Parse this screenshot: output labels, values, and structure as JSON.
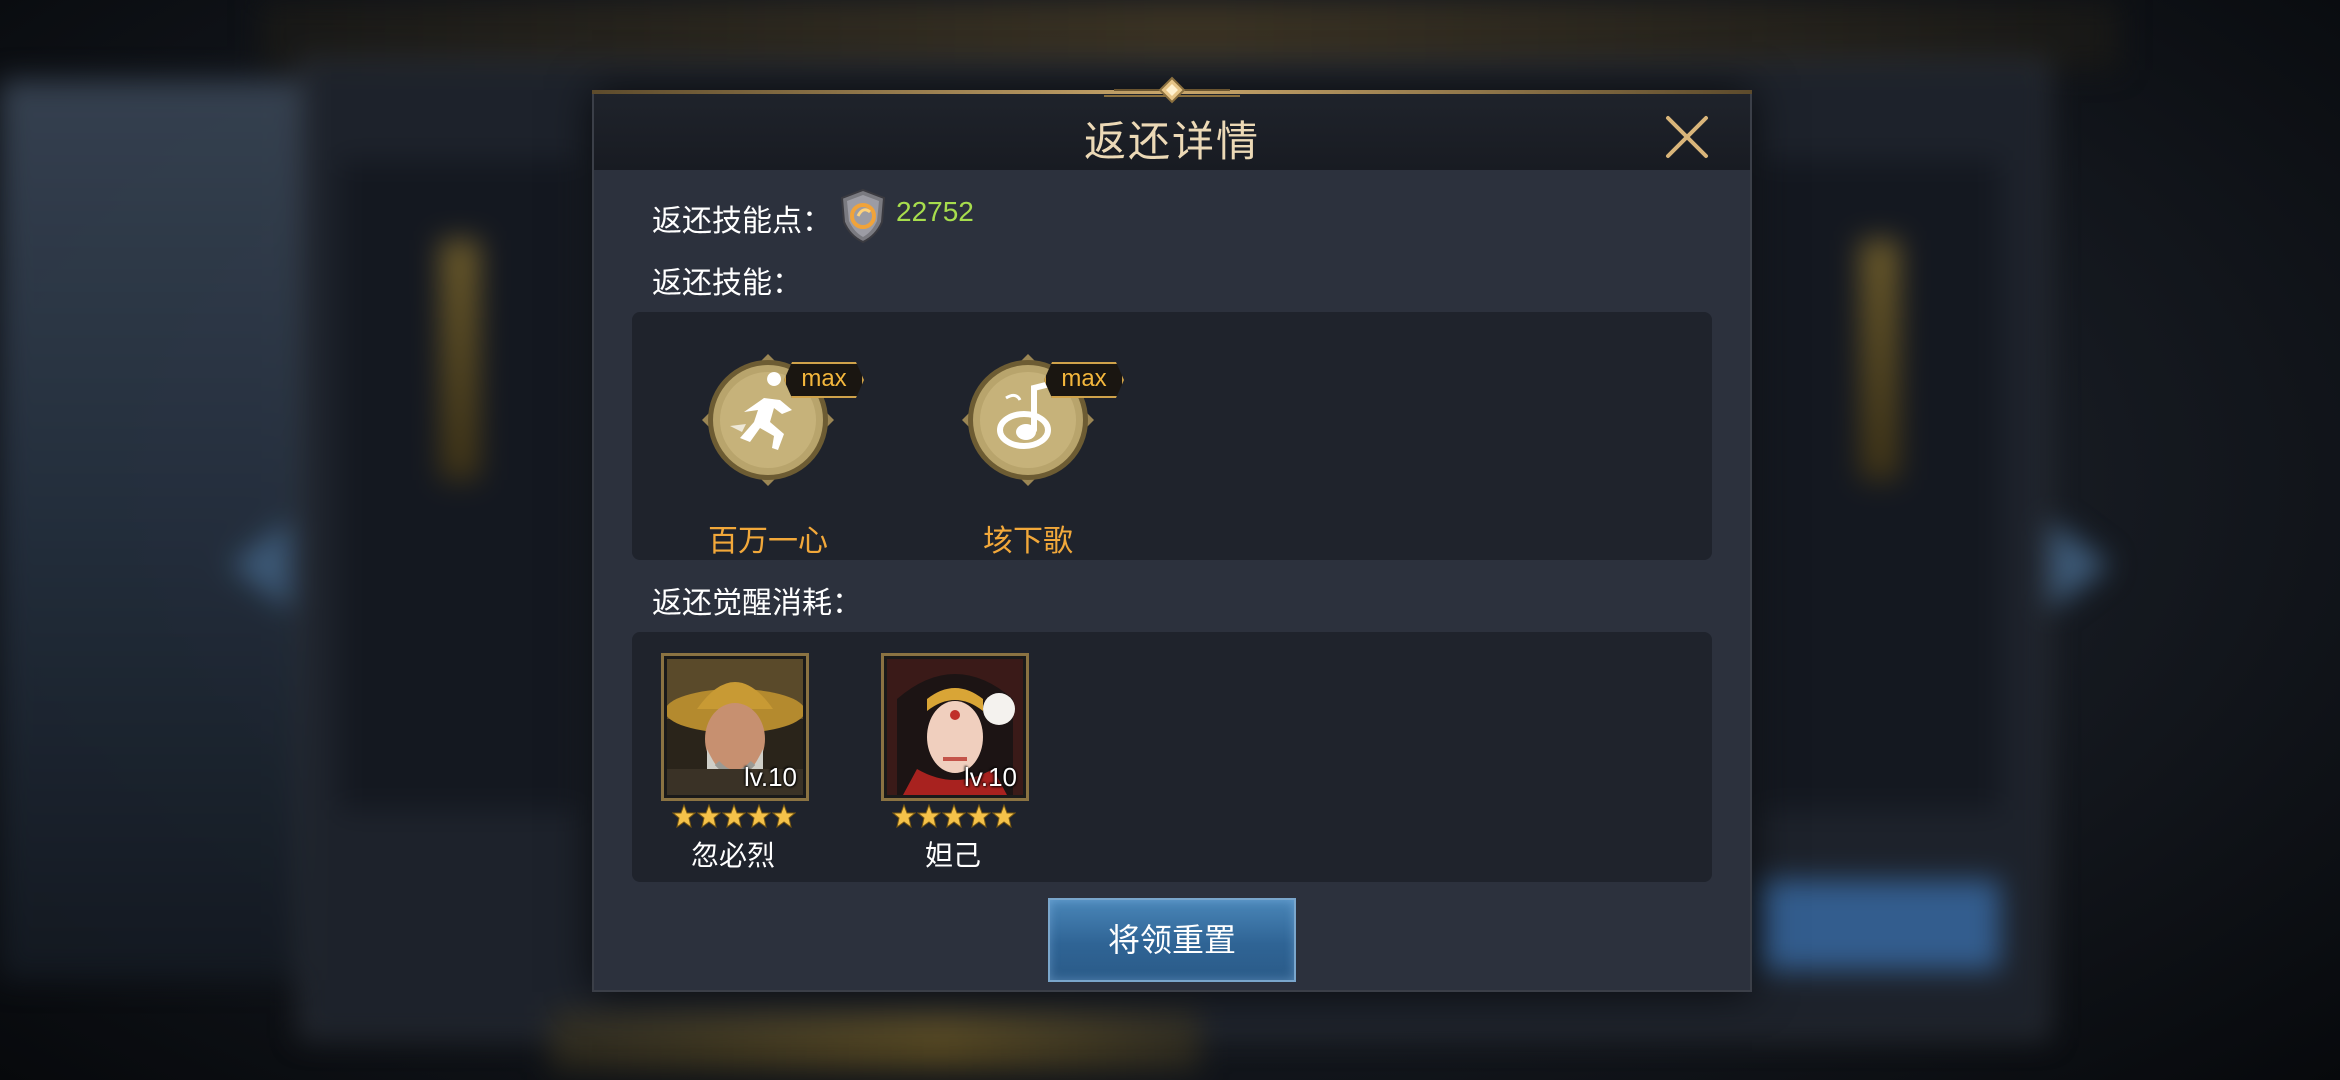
{
  "dialog": {
    "title": "返还详情",
    "points_label": "返还技能点：",
    "points_value": "22752",
    "skills_label": "返还技能：",
    "awaken_label": "返还觉醒消耗：",
    "reset_button": "将领重置"
  },
  "skills": [
    {
      "name": "百万一心",
      "badge": "max",
      "icon": "running-figure-icon"
    },
    {
      "name": "垓下歌",
      "badge": "max",
      "icon": "music-note-icon"
    }
  ],
  "heroes": [
    {
      "name": "忽必烈",
      "level": "lv.10",
      "stars": 5,
      "portrait": "hero-portrait-kublai"
    },
    {
      "name": "妲己",
      "level": "lv.10",
      "stars": 5,
      "portrait": "hero-portrait-daji"
    }
  ],
  "colors": {
    "title": "#ecd9b6",
    "points_value": "#a7dd4d",
    "skill_name": "#f2a83a",
    "button": "#2f6495"
  }
}
